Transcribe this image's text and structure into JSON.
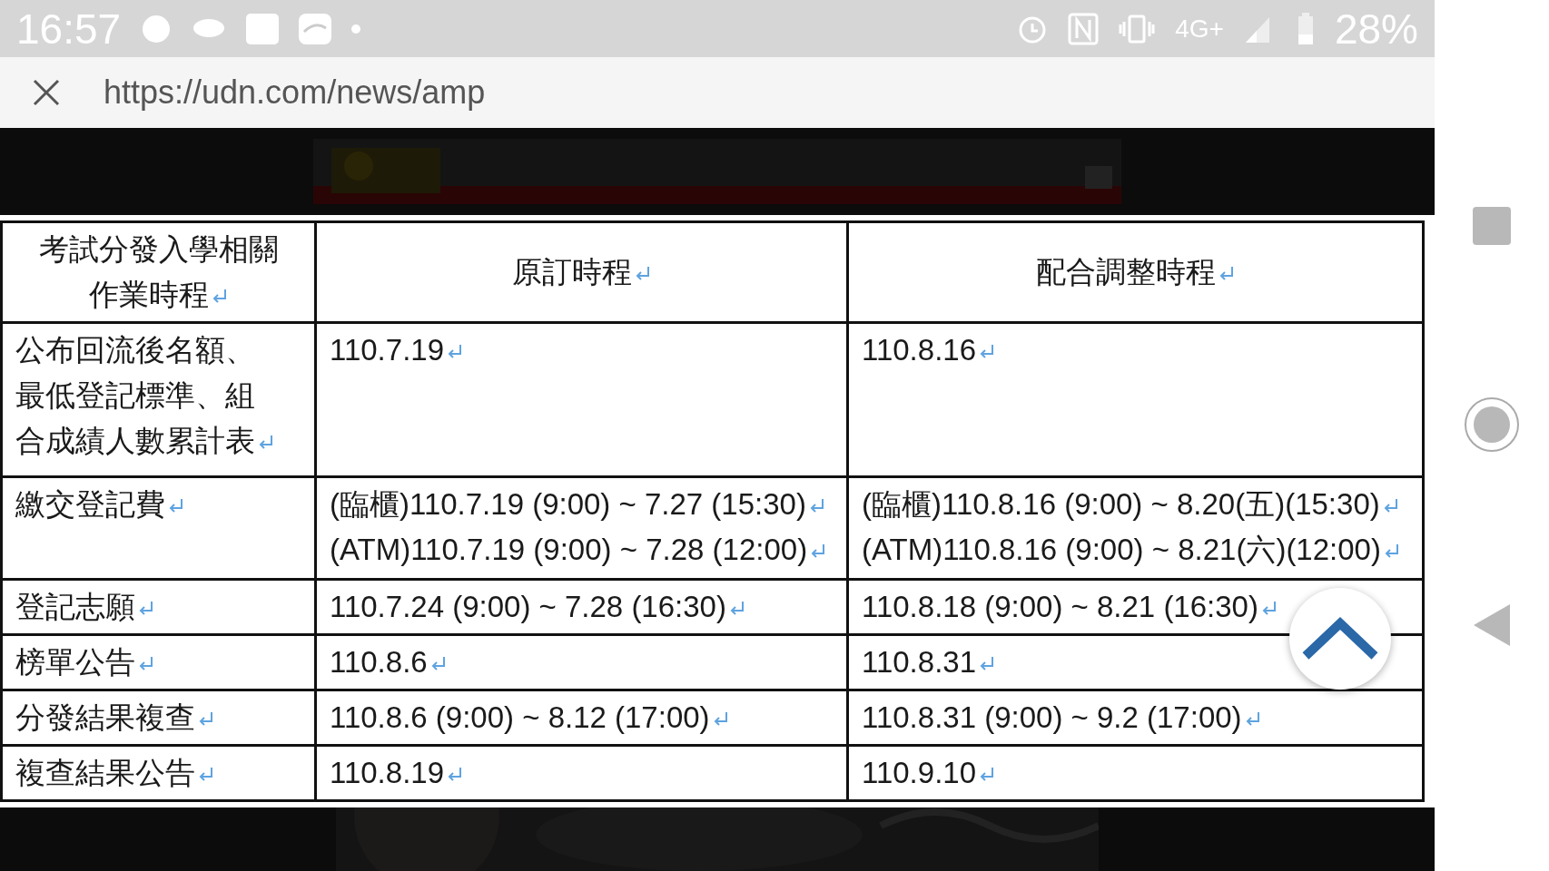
{
  "status_bar": {
    "time": "16:57",
    "network": "4G+",
    "battery": "28%"
  },
  "url_bar": {
    "url": "https://udn.com/news/amp"
  },
  "table": {
    "columns": [
      {
        "paragraphs": [
          [
            "考試分發入學相關",
            "作業時程"
          ]
        ]
      },
      {
        "paragraphs": [
          [
            "原訂時程"
          ]
        ]
      },
      {
        "paragraphs": [
          [
            "配合調整時程"
          ]
        ]
      }
    ],
    "rows": [
      {
        "cells": [
          {
            "paragraphs": [
              [
                "公布回流後名額、",
                "最低登記標準、組",
                "合成績人數累計表"
              ]
            ]
          },
          {
            "paragraphs": [
              [
                "110.7.19"
              ]
            ]
          },
          {
            "paragraphs": [
              [
                "110.8.16"
              ]
            ]
          }
        ]
      },
      {
        "cells": [
          {
            "paragraphs": [
              [
                "繳交登記費"
              ]
            ]
          },
          {
            "paragraphs": [
              [
                "(臨櫃)110.7.19 (9:00) ~ 7.27 (15:30)"
              ],
              [
                "(ATM)110.7.19 (9:00) ~ 7.28 (12:00)"
              ]
            ]
          },
          {
            "paragraphs": [
              [
                "(臨櫃)110.8.16 (9:00) ~ 8.20(五)(15:30)"
              ],
              [
                "(ATM)110.8.16 (9:00) ~ 8.21(六)(12:00)"
              ]
            ]
          }
        ]
      },
      {
        "cells": [
          {
            "paragraphs": [
              [
                "登記志願"
              ]
            ]
          },
          {
            "paragraphs": [
              [
                "110.7.24 (9:00) ~ 7.28 (16:30)"
              ]
            ]
          },
          {
            "paragraphs": [
              [
                "110.8.18 (9:00) ~ 8.21 (16:30)"
              ]
            ]
          }
        ]
      },
      {
        "cells": [
          {
            "paragraphs": [
              [
                "榜單公告"
              ]
            ]
          },
          {
            "paragraphs": [
              [
                "110.8.6"
              ]
            ]
          },
          {
            "paragraphs": [
              [
                "110.8.31"
              ]
            ]
          }
        ]
      },
      {
        "cells": [
          {
            "paragraphs": [
              [
                "分發結果複查"
              ]
            ]
          },
          {
            "paragraphs": [
              [
                "110.8.6 (9:00) ~ 8.12 (17:00)"
              ]
            ]
          },
          {
            "paragraphs": [
              [
                "110.8.31 (9:00) ~ 9.2 (17:00)"
              ]
            ]
          }
        ]
      },
      {
        "cells": [
          {
            "paragraphs": [
              [
                "複查結果公告"
              ]
            ]
          },
          {
            "paragraphs": [
              [
                "110.8.19"
              ]
            ]
          },
          {
            "paragraphs": [
              [
                "110.9.10"
              ]
            ]
          }
        ]
      }
    ]
  }
}
